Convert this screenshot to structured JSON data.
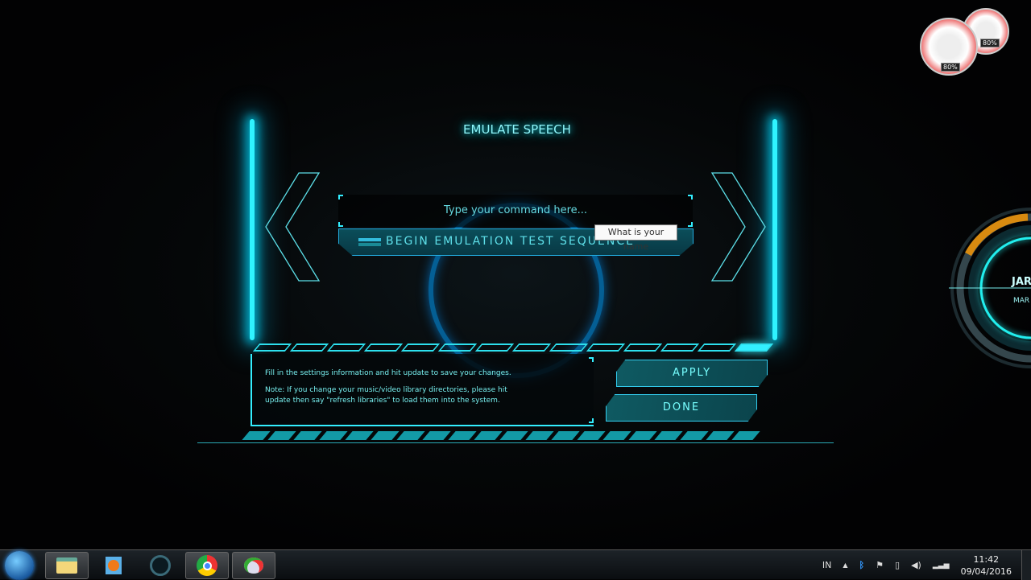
{
  "dialog": {
    "title": "EMULATE SPEECH",
    "command_input": {
      "placeholder": "Type your command here...",
      "value": ""
    },
    "begin_button": "BEGIN EMULATION TEST SEQUENCE",
    "tooltip": "What is your name",
    "info_lines": [
      "Fill in the settings information and hit update to save your changes.",
      "Note: If you change your music/video library directories, please hit update then say \"refresh libraries\" to load them into the system."
    ],
    "apply_button": "APPLY",
    "done_button": "DONE",
    "accent_color": "#2ff3ff"
  },
  "gadgets": {
    "cpu_percent": "80%",
    "memory_percent": "80%",
    "hud_partial_text": [
      "JAR",
      "MAR"
    ]
  },
  "taskbar": {
    "apps": [
      {
        "icon": "windows-start-icon"
      },
      {
        "icon": "file-explorer-icon"
      },
      {
        "icon": "media-player-icon"
      },
      {
        "icon": "jarvis-icon"
      },
      {
        "icon": "chrome-icon"
      },
      {
        "icon": "paint-icon"
      }
    ],
    "tray": {
      "language": "IN",
      "time": "11:42",
      "date": "09/04/2016"
    }
  }
}
